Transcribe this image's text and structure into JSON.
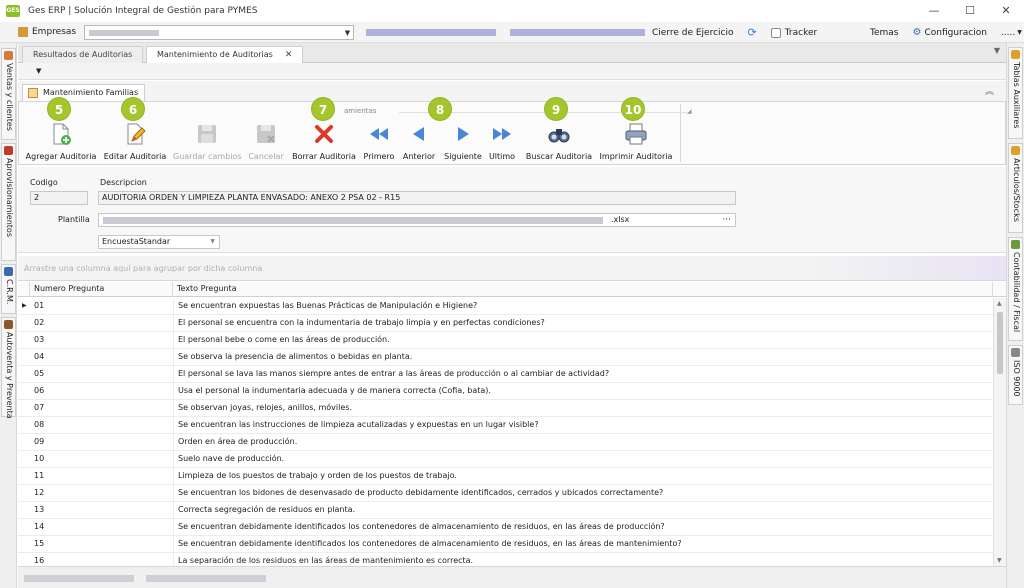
{
  "window": {
    "title": "Ges ERP | Solución Integral de Gestión para PYMES",
    "logo_text": "GES",
    "minimize": "—",
    "maximize": "☐",
    "close": "✕"
  },
  "menubar": {
    "empresas_label": "Empresas",
    "cierre_label": "Cierre de Ejercicio",
    "tracker_label": "Tracker",
    "temas_label": "Temas",
    "configuracion_label": "Configuracion",
    "more_label": "....."
  },
  "left_tabs": [
    "Ventas y clientes",
    "Aprovisionamientos",
    "C.R.M.",
    "Autoventa y Preventa"
  ],
  "right_tabs": [
    "Tablas Auxiliares",
    "Articulos/Stocks",
    "Contabilidad / Fiscal",
    "ISO 9000"
  ],
  "doc_tabs": [
    {
      "label": "Resultados de Auditorias",
      "active": false
    },
    {
      "label": "Mantenimiento de Auditorias",
      "active": true,
      "close": "✕"
    }
  ],
  "ribbon": {
    "tab_label": "Mantenimiento Familias",
    "group_label": "amientas",
    "buttons": [
      {
        "label": "Agregar Auditoria",
        "icon": "add-document-icon",
        "enabled": true
      },
      {
        "label": "Editar Auditoria",
        "icon": "edit-document-icon",
        "enabled": true
      },
      {
        "label": "Guardar cambios",
        "icon": "save-icon",
        "enabled": false
      },
      {
        "label": "Cancelar",
        "icon": "cancel-save-icon",
        "enabled": false
      },
      {
        "label": "Borrar Auditoria",
        "icon": "delete-icon",
        "enabled": true
      },
      {
        "label": "Primero",
        "icon": "first-icon",
        "enabled": true
      },
      {
        "label": "Anterior",
        "icon": "previous-icon",
        "enabled": true
      },
      {
        "label": "Siguiente",
        "icon": "next-icon",
        "enabled": true
      },
      {
        "label": "Ultimo",
        "icon": "last-icon",
        "enabled": true
      },
      {
        "label": "Buscar Auditoria",
        "icon": "binoculars-icon",
        "enabled": true
      },
      {
        "label": "Imprimir Auditoria",
        "icon": "printer-icon",
        "enabled": true
      }
    ],
    "callouts": [
      "5",
      "6",
      "7",
      "8",
      "9",
      "10"
    ]
  },
  "form": {
    "codigo_label": "Codigo",
    "codigo_value": "2",
    "descripcion_label": "Descripcion",
    "descripcion_value": "AUDITORIA ORDEN Y LIMPIEZA PLANTA ENVASADO: ANEXO 2 PSA 02 - R15",
    "plantilla_label": "Plantilla",
    "plantilla_suffix": ".xlsx",
    "plantilla_button": "···",
    "encuesta_value": "EncuestaStandar"
  },
  "grid": {
    "group_hint": "Arrastre una columna aquí para agrupar por dicha columna",
    "columns": [
      "Numero Pregunta",
      "Texto Pregunta"
    ],
    "rows": [
      [
        "01",
        "Se encuentran expuestas las Buenas Prácticas de Manipulación e Higiene?"
      ],
      [
        "02",
        "El personal se encuentra con la indumentaria de trabajo limpia y en perfectas condiciones?"
      ],
      [
        "03",
        "El personal bebe o come en las áreas de producción."
      ],
      [
        "04",
        "Se observa la presencia de alimentos o bebidas en planta."
      ],
      [
        "05",
        "El personal se lava las manos siempre antes de entrar a las áreas de producción o al cambiar de actividad?"
      ],
      [
        "06",
        "Usa el personal la indumentaria adecuada y de manera correcta (Cofia, bata)."
      ],
      [
        "07",
        "Se observan joyas, relojes, anillos, móviles."
      ],
      [
        "08",
        "Se encuentran las instrucciones de limpieza acutalizadas y expuestas en un lugar visible?"
      ],
      [
        "09",
        "Orden en área de producción."
      ],
      [
        "10",
        "Suelo nave de producción."
      ],
      [
        "11",
        "Limpieza de los puestos de trabajo y orden de los puestos de trabajo."
      ],
      [
        "12",
        "Se encuentran los bidones de desenvasado de producto debidamente identificados, cerrados y ubicados correctamente?"
      ],
      [
        "13",
        "Correcta segregación de residuos en planta."
      ],
      [
        "14",
        "Se encuentran debidamente identificados los contenedores de almacenamiento de residuos, en las áreas de producción?"
      ],
      [
        "15",
        "Se encuentran debidamente identificados los contenedores de almacenamiento de residuos, en las áreas de mantenimiento?"
      ],
      [
        "16",
        "La separación de los residuos en las áreas de mantenimiento es correcta."
      ]
    ],
    "selected_indicator": "▶"
  },
  "colors": {
    "callout": "#a3c62c",
    "delete_red": "#d93a2b",
    "nav_blue": "#4a86d8"
  }
}
